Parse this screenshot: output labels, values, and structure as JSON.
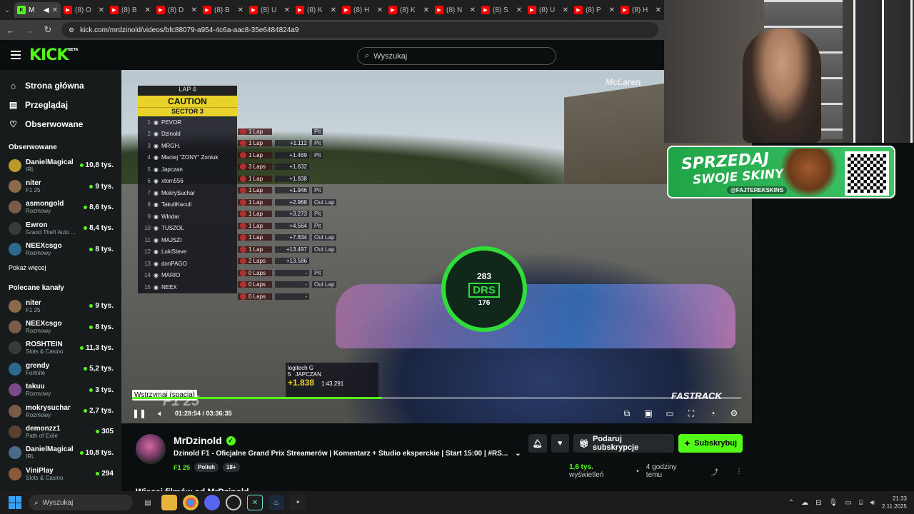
{
  "browser": {
    "tabs": [
      {
        "title": "M",
        "favicon": "kick",
        "active": true
      },
      {
        "title": "(8) O",
        "favicon": "youtube"
      },
      {
        "title": "(8) B",
        "favicon": "youtube"
      },
      {
        "title": "(8) D",
        "favicon": "youtube"
      },
      {
        "title": "(8) B",
        "favicon": "youtube"
      },
      {
        "title": "(8) U",
        "favicon": "youtube"
      },
      {
        "title": "(8) K",
        "favicon": "youtube"
      },
      {
        "title": "(8) H",
        "favicon": "youtube"
      },
      {
        "title": "(8) K",
        "favicon": "youtube"
      },
      {
        "title": "(8) N",
        "favicon": "youtube"
      },
      {
        "title": "(8) S",
        "favicon": "youtube"
      },
      {
        "title": "(8) U",
        "favicon": "youtube"
      },
      {
        "title": "(8) P",
        "favicon": "youtube"
      },
      {
        "title": "(8) H",
        "favicon": "youtube"
      }
    ],
    "url": "kick.com/mrdzinold/videos/bfc88079-a954-4c6a-aac8-35e6484824a9"
  },
  "header": {
    "logo": "KICK",
    "logo_badge": "BETA",
    "search_placeholder": "Wyszukaj"
  },
  "sidebar": {
    "nav": [
      {
        "label": "Strona główna",
        "icon": "home-icon"
      },
      {
        "label": "Przeglądaj",
        "icon": "browse-icon"
      },
      {
        "label": "Obserwowane",
        "icon": "heart-icon"
      }
    ],
    "followed_title": "Obserwowane",
    "followed": [
      {
        "name": "DanielMagical",
        "category": "IRL",
        "viewers": "10,8 tys."
      },
      {
        "name": "niter",
        "category": "F1 25",
        "viewers": "9 tys."
      },
      {
        "name": "asmongold",
        "category": "Rozmowy",
        "viewers": "8,6 tys."
      },
      {
        "name": "Ewron",
        "category": "Grand Theft Auto ...",
        "viewers": "8,4 tys."
      },
      {
        "name": "NEEXcsgo",
        "category": "Rozmowy",
        "viewers": "8 tys."
      }
    ],
    "show_more": "Pokaż więcej",
    "recommended_title": "Polecane kanały",
    "recommended": [
      {
        "name": "niter",
        "category": "F1 25",
        "viewers": "9 tys."
      },
      {
        "name": "NEEXcsgo",
        "category": "Rozmowy",
        "viewers": "8 tys."
      },
      {
        "name": "ROSHTEIN",
        "category": "Slots & Casino",
        "viewers": "11,3 tys."
      },
      {
        "name": "grendy",
        "category": "Fortnite",
        "viewers": "5,2 tys."
      },
      {
        "name": "takuu",
        "category": "Rozmowy",
        "viewers": "3 tys."
      },
      {
        "name": "mokrysuchar",
        "category": "Rozmowy",
        "viewers": "2,7 tys."
      },
      {
        "name": "demonzz1",
        "category": "Path of Exile",
        "viewers": "305"
      },
      {
        "name": "DanielMagical",
        "category": "IRL",
        "viewers": "10,8 tys."
      },
      {
        "name": "ViniPlay",
        "category": "Slots & Casino",
        "viewers": "294"
      }
    ]
  },
  "player": {
    "tooltip": "Wstrzymaj (spacja)",
    "current_time": "01:28:54",
    "duration": "03:36:35",
    "progress": 0.41,
    "overlay": {
      "brand": "McLaren",
      "lap": "LAP 4",
      "caution": "CAUTION",
      "sector": "SECTOR 3",
      "speed": "283",
      "drs": "DRS",
      "speed2": "176",
      "fastrack": "FASTRACK",
      "game_logo": "F1 25",
      "driver_box_driver": "JAPCZAN",
      "driver_box_pos": "5",
      "driver_box_gap": "+1.838",
      "driver_box_time": "1:43.291",
      "driver_box_sponsor": "logitech G",
      "standings": [
        {
          "pos": "1",
          "name": "PEVOR",
          "laps": "1 Lap",
          "gap": "",
          "status": "Pit"
        },
        {
          "pos": "2",
          "name": "Dzinold",
          "laps": "1 Lap",
          "gap": "+1.112",
          "status": "Pit"
        },
        {
          "pos": "3",
          "name": "MRGH.",
          "laps": "1 Lap",
          "gap": "+1.469",
          "status": "Pit"
        },
        {
          "pos": "4",
          "name": "Maciej \"ZONY\" Zoniuk",
          "laps": "3 Laps",
          "gap": "+1.632",
          "status": ""
        },
        {
          "pos": "5",
          "name": "Japczan",
          "laps": "1 Lap",
          "gap": "+1.838",
          "status": ""
        },
        {
          "pos": "6",
          "name": "xtom556",
          "laps": "1 Lap",
          "gap": "+1.946",
          "status": "Pit"
        },
        {
          "pos": "7",
          "name": "MokrySuchar",
          "laps": "1 Lap",
          "gap": "+2.968",
          "status": "Out Lap"
        },
        {
          "pos": "8",
          "name": "TakuliKaculi",
          "laps": "1 Lap",
          "gap": "+3.273",
          "status": "Pit"
        },
        {
          "pos": "9",
          "name": "Wlodar",
          "laps": "1 Lap",
          "gap": "+4.564",
          "status": "Pit"
        },
        {
          "pos": "10",
          "name": "TUSZOL",
          "laps": "1 Lap",
          "gap": "+7.834",
          "status": "Out Lap"
        },
        {
          "pos": "11",
          "name": "MAJSZI",
          "laps": "1 Lap",
          "gap": "+13.497",
          "status": "Out Lap"
        },
        {
          "pos": "12",
          "name": "LukiSteve",
          "laps": "2 Laps",
          "gap": "+13.586",
          "status": ""
        },
        {
          "pos": "13",
          "name": "donPAGO",
          "laps": "0 Laps",
          "gap": "-",
          "status": "Pit"
        },
        {
          "pos": "14",
          "name": "MARIO",
          "laps": "0 Laps",
          "gap": "-",
          "status": "Out Lap"
        },
        {
          "pos": "15",
          "name": "NEEX",
          "laps": "0 Laps",
          "gap": "-",
          "status": ""
        }
      ]
    }
  },
  "promo": {
    "line1": "SPRZEDAJ",
    "line2": "SWOJE SKINY",
    "handle": "@FAJTEREKSKINS"
  },
  "stream": {
    "streamer": "MrDzinold",
    "title": "Dzinold F1 - Oficjalne Grand Prix Streamerów | Komentarz + Studio eksperckie | Start 15:00 | #RS...",
    "category": "F1 25",
    "tags": [
      "Polish",
      "18+"
    ],
    "gift_label": "Podaruj subskrypcje",
    "subscribe_label": "Subskrybuj",
    "views": "1,6 tys.",
    "views_label": "wyświetleń",
    "age": "4 godziny temu",
    "more_videos": "Więcej filmów od MrDzinold"
  },
  "taskbar": {
    "search": "Wyszukaj",
    "time": "21:33",
    "date": "2.11.2025"
  },
  "colors": {
    "accent": "#53fc18",
    "bg": "#0b0e0f",
    "sidebar": "#181b1c"
  }
}
